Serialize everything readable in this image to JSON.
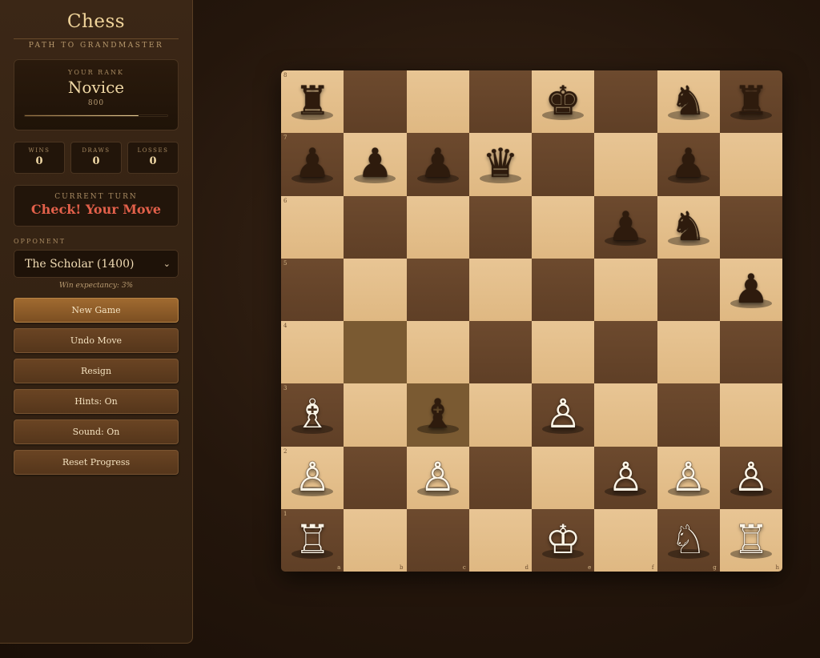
{
  "app": {
    "title": "Chess",
    "subtitle": "PATH TO GRANDMASTER"
  },
  "rank": {
    "caption": "YOUR RANK",
    "name": "Novice",
    "elo": "800",
    "progress": 0.8
  },
  "stats": [
    {
      "label": "WINS",
      "value": "0"
    },
    {
      "label": "DRAWS",
      "value": "0"
    },
    {
      "label": "LOSSES",
      "value": "0"
    }
  ],
  "turn": {
    "caption": "CURRENT TURN",
    "status": "Check! Your Move"
  },
  "opponent": {
    "label": "OPPONENT",
    "selected": "The Scholar (1400)",
    "win_expectancy": "Win expectancy: 3%"
  },
  "buttons": {
    "new_game": "New Game",
    "undo": "Undo Move",
    "resign": "Resign",
    "hints": "Hints: On",
    "sound": "Sound: On",
    "reset": "Reset Progress"
  },
  "board": {
    "files": [
      "a",
      "b",
      "c",
      "d",
      "e",
      "f",
      "g",
      "h"
    ],
    "ranks": [
      "8",
      "7",
      "6",
      "5",
      "4",
      "3",
      "2",
      "1"
    ],
    "highlighted": [
      "b4",
      "c3"
    ],
    "pieces": [
      {
        "square": "a8",
        "color": "black",
        "type": "rook"
      },
      {
        "square": "e8",
        "color": "black",
        "type": "king"
      },
      {
        "square": "g8",
        "color": "black",
        "type": "knight"
      },
      {
        "square": "h8",
        "color": "black",
        "type": "rook"
      },
      {
        "square": "a7",
        "color": "black",
        "type": "pawn"
      },
      {
        "square": "b7",
        "color": "black",
        "type": "pawn"
      },
      {
        "square": "c7",
        "color": "black",
        "type": "pawn"
      },
      {
        "square": "d7",
        "color": "black",
        "type": "queen"
      },
      {
        "square": "g7",
        "color": "black",
        "type": "pawn"
      },
      {
        "square": "f6",
        "color": "black",
        "type": "pawn"
      },
      {
        "square": "g6",
        "color": "black",
        "type": "knight"
      },
      {
        "square": "h5",
        "color": "black",
        "type": "pawn"
      },
      {
        "square": "a3",
        "color": "white",
        "type": "bishop"
      },
      {
        "square": "c3",
        "color": "black",
        "type": "bishop"
      },
      {
        "square": "e3",
        "color": "white",
        "type": "pawn"
      },
      {
        "square": "a2",
        "color": "white",
        "type": "pawn"
      },
      {
        "square": "c2",
        "color": "white",
        "type": "pawn"
      },
      {
        "square": "f2",
        "color": "white",
        "type": "pawn"
      },
      {
        "square": "g2",
        "color": "white",
        "type": "pawn"
      },
      {
        "square": "h2",
        "color": "white",
        "type": "pawn"
      },
      {
        "square": "a1",
        "color": "white",
        "type": "rook"
      },
      {
        "square": "e1",
        "color": "white",
        "type": "king"
      },
      {
        "square": "g1",
        "color": "white",
        "type": "knight"
      },
      {
        "square": "h1",
        "color": "white",
        "type": "rook"
      }
    ]
  }
}
